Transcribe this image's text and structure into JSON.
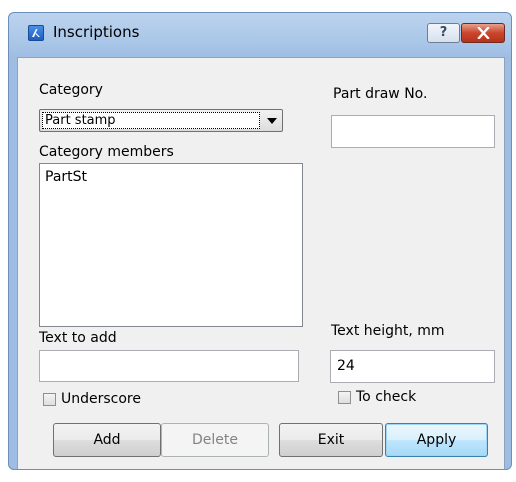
{
  "window": {
    "title": "Inscriptions",
    "help_label": "?",
    "icons": {
      "app": "app-logo-icon",
      "close": "close-icon"
    }
  },
  "category": {
    "label": "Category",
    "selected": "Part stamp"
  },
  "members": {
    "label": "Category members",
    "items": [
      "PartSt"
    ]
  },
  "part_draw": {
    "label": "Part draw No.",
    "value": ""
  },
  "text_to_add": {
    "label": "Text to add",
    "value": ""
  },
  "text_height": {
    "label": "Text height, mm",
    "value": "24"
  },
  "checkboxes": {
    "underscore": "Underscore",
    "to_check": "To check"
  },
  "buttons": {
    "add": "Add",
    "delete": "Delete",
    "exit": "Exit",
    "apply": "Apply"
  },
  "colors": {
    "title_bar": "#a9c6e8",
    "dialog_bg": "#f0f0f0",
    "close_button": "#c9452b",
    "default_button": "#bee6fd"
  }
}
